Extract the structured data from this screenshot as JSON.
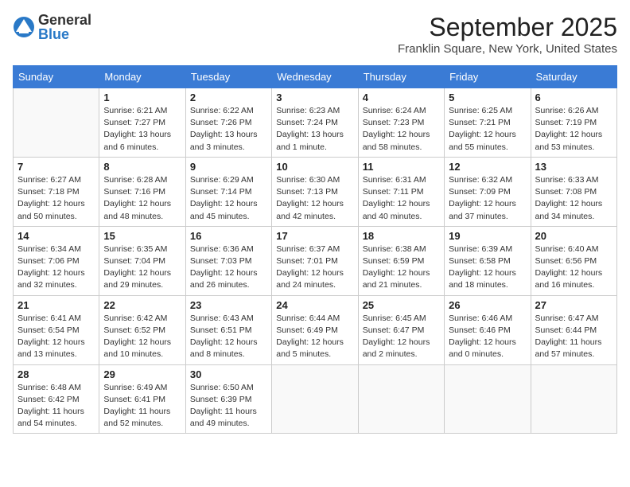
{
  "logo": {
    "general": "General",
    "blue": "Blue"
  },
  "title": "September 2025",
  "location": "Franklin Square, New York, United States",
  "days_of_week": [
    "Sunday",
    "Monday",
    "Tuesday",
    "Wednesday",
    "Thursday",
    "Friday",
    "Saturday"
  ],
  "weeks": [
    [
      {
        "day": "",
        "info": ""
      },
      {
        "day": "1",
        "info": "Sunrise: 6:21 AM\nSunset: 7:27 PM\nDaylight: 13 hours\nand 6 minutes."
      },
      {
        "day": "2",
        "info": "Sunrise: 6:22 AM\nSunset: 7:26 PM\nDaylight: 13 hours\nand 3 minutes."
      },
      {
        "day": "3",
        "info": "Sunrise: 6:23 AM\nSunset: 7:24 PM\nDaylight: 13 hours\nand 1 minute."
      },
      {
        "day": "4",
        "info": "Sunrise: 6:24 AM\nSunset: 7:23 PM\nDaylight: 12 hours\nand 58 minutes."
      },
      {
        "day": "5",
        "info": "Sunrise: 6:25 AM\nSunset: 7:21 PM\nDaylight: 12 hours\nand 55 minutes."
      },
      {
        "day": "6",
        "info": "Sunrise: 6:26 AM\nSunset: 7:19 PM\nDaylight: 12 hours\nand 53 minutes."
      }
    ],
    [
      {
        "day": "7",
        "info": "Sunrise: 6:27 AM\nSunset: 7:18 PM\nDaylight: 12 hours\nand 50 minutes."
      },
      {
        "day": "8",
        "info": "Sunrise: 6:28 AM\nSunset: 7:16 PM\nDaylight: 12 hours\nand 48 minutes."
      },
      {
        "day": "9",
        "info": "Sunrise: 6:29 AM\nSunset: 7:14 PM\nDaylight: 12 hours\nand 45 minutes."
      },
      {
        "day": "10",
        "info": "Sunrise: 6:30 AM\nSunset: 7:13 PM\nDaylight: 12 hours\nand 42 minutes."
      },
      {
        "day": "11",
        "info": "Sunrise: 6:31 AM\nSunset: 7:11 PM\nDaylight: 12 hours\nand 40 minutes."
      },
      {
        "day": "12",
        "info": "Sunrise: 6:32 AM\nSunset: 7:09 PM\nDaylight: 12 hours\nand 37 minutes."
      },
      {
        "day": "13",
        "info": "Sunrise: 6:33 AM\nSunset: 7:08 PM\nDaylight: 12 hours\nand 34 minutes."
      }
    ],
    [
      {
        "day": "14",
        "info": "Sunrise: 6:34 AM\nSunset: 7:06 PM\nDaylight: 12 hours\nand 32 minutes."
      },
      {
        "day": "15",
        "info": "Sunrise: 6:35 AM\nSunset: 7:04 PM\nDaylight: 12 hours\nand 29 minutes."
      },
      {
        "day": "16",
        "info": "Sunrise: 6:36 AM\nSunset: 7:03 PM\nDaylight: 12 hours\nand 26 minutes."
      },
      {
        "day": "17",
        "info": "Sunrise: 6:37 AM\nSunset: 7:01 PM\nDaylight: 12 hours\nand 24 minutes."
      },
      {
        "day": "18",
        "info": "Sunrise: 6:38 AM\nSunset: 6:59 PM\nDaylight: 12 hours\nand 21 minutes."
      },
      {
        "day": "19",
        "info": "Sunrise: 6:39 AM\nSunset: 6:58 PM\nDaylight: 12 hours\nand 18 minutes."
      },
      {
        "day": "20",
        "info": "Sunrise: 6:40 AM\nSunset: 6:56 PM\nDaylight: 12 hours\nand 16 minutes."
      }
    ],
    [
      {
        "day": "21",
        "info": "Sunrise: 6:41 AM\nSunset: 6:54 PM\nDaylight: 12 hours\nand 13 minutes."
      },
      {
        "day": "22",
        "info": "Sunrise: 6:42 AM\nSunset: 6:52 PM\nDaylight: 12 hours\nand 10 minutes."
      },
      {
        "day": "23",
        "info": "Sunrise: 6:43 AM\nSunset: 6:51 PM\nDaylight: 12 hours\nand 8 minutes."
      },
      {
        "day": "24",
        "info": "Sunrise: 6:44 AM\nSunset: 6:49 PM\nDaylight: 12 hours\nand 5 minutes."
      },
      {
        "day": "25",
        "info": "Sunrise: 6:45 AM\nSunset: 6:47 PM\nDaylight: 12 hours\nand 2 minutes."
      },
      {
        "day": "26",
        "info": "Sunrise: 6:46 AM\nSunset: 6:46 PM\nDaylight: 12 hours\nand 0 minutes."
      },
      {
        "day": "27",
        "info": "Sunrise: 6:47 AM\nSunset: 6:44 PM\nDaylight: 11 hours\nand 57 minutes."
      }
    ],
    [
      {
        "day": "28",
        "info": "Sunrise: 6:48 AM\nSunset: 6:42 PM\nDaylight: 11 hours\nand 54 minutes."
      },
      {
        "day": "29",
        "info": "Sunrise: 6:49 AM\nSunset: 6:41 PM\nDaylight: 11 hours\nand 52 minutes."
      },
      {
        "day": "30",
        "info": "Sunrise: 6:50 AM\nSunset: 6:39 PM\nDaylight: 11 hours\nand 49 minutes."
      },
      {
        "day": "",
        "info": ""
      },
      {
        "day": "",
        "info": ""
      },
      {
        "day": "",
        "info": ""
      },
      {
        "day": "",
        "info": ""
      }
    ]
  ]
}
